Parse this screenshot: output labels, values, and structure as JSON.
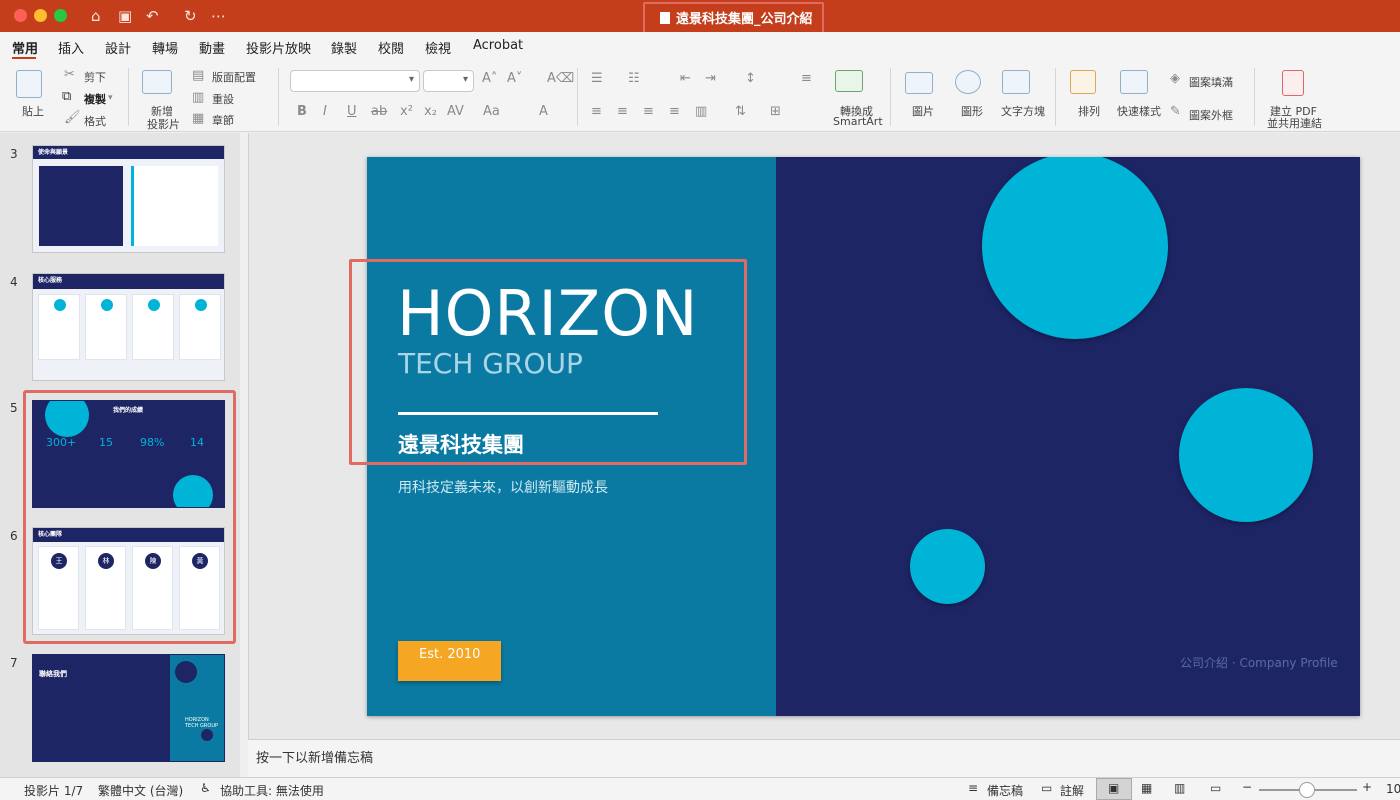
{
  "window": {
    "title": "遠景科技集團_公司介紹"
  },
  "tabs": [
    "常用",
    "插入",
    "設計",
    "轉場",
    "動畫",
    "投影片放映",
    "錄製",
    "校閱",
    "檢視",
    "Acrobat"
  ],
  "ribbon": {
    "paste": "貼上",
    "cut": "剪下",
    "copy": "複製",
    "format": "格式",
    "new_slide_1": "新增",
    "new_slide_2": "投影片",
    "layout": "版面配置",
    "reset": "重設",
    "section": "章節",
    "convert_1": "轉換成",
    "convert_2": "SmartArt",
    "picture": "圖片",
    "shape": "圖形",
    "textbox": "文字方塊",
    "arrange": "排列",
    "quick_styles": "快速樣式",
    "shape_fill": "圖案填滿",
    "shape_outline": "圖案外框",
    "pdf_1": "建立 PDF",
    "pdf_2": "並共用連結"
  },
  "thumbnails": {
    "numbers": [
      "3",
      "4",
      "5",
      "6",
      "7"
    ],
    "s3": {
      "title": "使命與願景"
    },
    "s4": {
      "title": "核心服務"
    },
    "s5": {
      "title": "我們的成績",
      "stats": [
        "300+",
        "15",
        "98%",
        "14"
      ]
    },
    "s6": {
      "title": "核心團隊",
      "avatars": [
        "王",
        "林",
        "陳",
        "黃"
      ]
    },
    "s7": {
      "title": "聯絡我們",
      "brand_1": "HORIZON",
      "brand_2": "TECH GROUP"
    }
  },
  "slide": {
    "title": "HORIZON",
    "subtitle": "TECH GROUP",
    "company": "遠景科技集團",
    "tagline": "用科技定義未來，以創新驅動成長",
    "established": "Est. 2010",
    "profile": "公司介紹 · Company Profile"
  },
  "notes": {
    "placeholder": "按一下以新增備忘稿"
  },
  "status": {
    "slide_count": "投影片 1/7",
    "language": "繁體中文 (台灣)",
    "accessibility": "協助工具: 無法使用",
    "notes": "備忘稿",
    "comments": "註解",
    "zoom": "10"
  },
  "colors": {
    "brand": "#c43e1c",
    "slide_dark": "#1e2565",
    "slide_teal": "#0b7aa2",
    "accent": "#00b4d8",
    "badge": "#f5a623",
    "highlight": "#e06b63"
  }
}
